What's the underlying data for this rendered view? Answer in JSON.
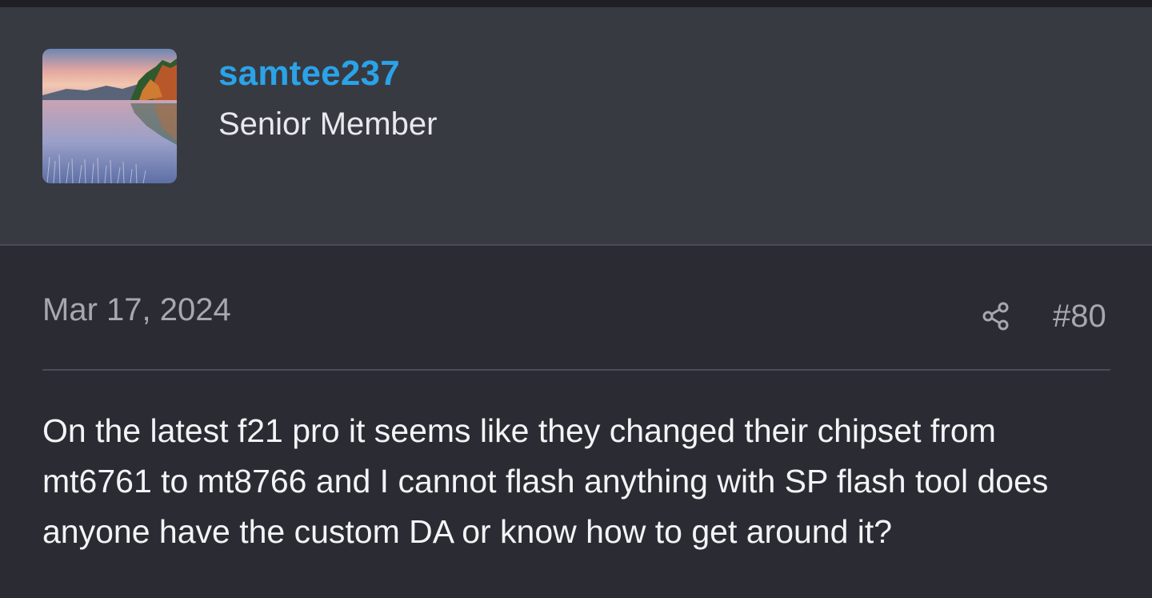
{
  "user": {
    "username": "samtee237",
    "title": "Senior Member",
    "avatar": "lake-landscape-avatar"
  },
  "post": {
    "date": "Mar 17, 2024",
    "number": "#80",
    "share_icon": "share-icon",
    "message": "On the latest f21 pro it seems like they changed their chipset from mt6761 to mt8766 and I cannot flash anything with SP flash tool does anyone have the custom DA or know how to get around it?"
  },
  "colors": {
    "header_bg": "#383a42",
    "body_bg": "#2b2c33",
    "username": "#2aa3e8",
    "muted_text": "#a6a8b0",
    "text": "#f3f4f6"
  }
}
